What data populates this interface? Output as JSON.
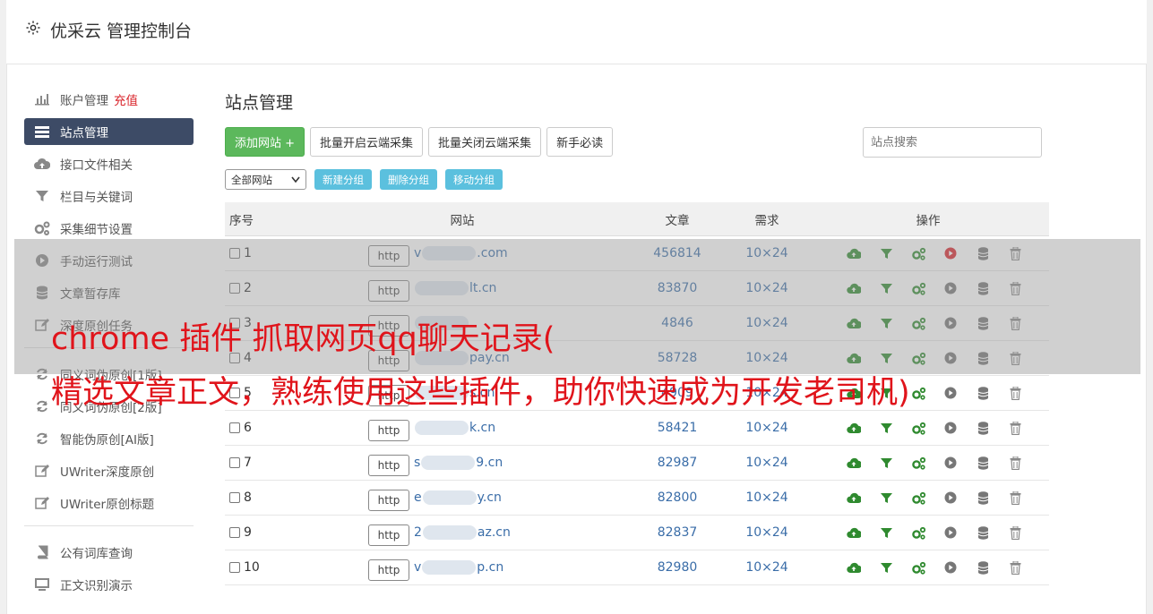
{
  "header": {
    "title": "优采云 管理控制台"
  },
  "sidebar": {
    "items": [
      {
        "label": "账户管理",
        "badge": "充值",
        "icon": "bar-chart-icon"
      },
      {
        "label": "站点管理",
        "icon": "server-icon",
        "active": true
      },
      {
        "label": "接口文件相关",
        "icon": "cloud-upload-icon"
      },
      {
        "label": "栏目与关键词",
        "icon": "filter-icon"
      },
      {
        "label": "采集细节设置",
        "icon": "cogs-icon"
      },
      {
        "label": "手动运行测试",
        "icon": "play-circle-icon"
      },
      {
        "label": "文章暂存库",
        "icon": "database-icon"
      },
      {
        "label": "深度原创任务",
        "icon": "edit-icon"
      },
      {
        "label": "同义词伪原创[1版]",
        "icon": "refresh-icon"
      },
      {
        "label": "同义词伪原创[2版]",
        "icon": "refresh-icon"
      },
      {
        "label": "智能伪原创[AI版]",
        "icon": "refresh-icon"
      },
      {
        "label": "UWriter深度原创",
        "icon": "edit-icon"
      },
      {
        "label": "UWriter原创标题",
        "icon": "edit-icon"
      },
      {
        "label": "公有词库查询",
        "icon": "book-icon"
      },
      {
        "label": "正文识别演示",
        "icon": "monitor-icon"
      }
    ]
  },
  "main": {
    "title": "站点管理",
    "buttons": {
      "add": "添加网站 +",
      "batch_on": "批量开启云端采集",
      "batch_off": "批量关闭云端采集",
      "guide": "新手必读"
    },
    "search_placeholder": "站点搜索",
    "filter": {
      "select_value": "全部网站",
      "new_group": "新建分组",
      "del_group": "删除分组",
      "move_group": "移动分组"
    },
    "table": {
      "headers": {
        "no": "序号",
        "site": "网站",
        "articles": "文章",
        "demand": "需求",
        "ops": "操作"
      },
      "rows": [
        {
          "no": "1",
          "proto": "http",
          "pre": "v",
          "suf": ".com",
          "articles": "456814",
          "demand": "10×24"
        },
        {
          "no": "2",
          "proto": "http",
          "pre": "",
          "suf": "lt.cn",
          "articles": "83870",
          "demand": "10×24"
        },
        {
          "no": "3",
          "proto": "http",
          "pre": "",
          "suf": "",
          "articles": "4846",
          "demand": "10×24"
        },
        {
          "no": "4",
          "proto": "http",
          "pre": "",
          "suf": "pay.cn",
          "articles": "58728",
          "demand": "10×24"
        },
        {
          "no": "5",
          "proto": "http",
          "pre": "",
          "suf": "s.cn",
          "articles": "4909",
          "demand": "10×24"
        },
        {
          "no": "6",
          "proto": "http",
          "pre": "",
          "suf": "k.cn",
          "articles": "58421",
          "demand": "10×24"
        },
        {
          "no": "7",
          "proto": "http",
          "pre": "s",
          "suf": "9.cn",
          "articles": "82987",
          "demand": "10×24"
        },
        {
          "no": "8",
          "proto": "http",
          "pre": "e",
          "suf": "y.cn",
          "articles": "82800",
          "demand": "10×24"
        },
        {
          "no": "9",
          "proto": "http",
          "pre": "2",
          "suf": "az.cn",
          "articles": "82837",
          "demand": "10×24"
        },
        {
          "no": "10",
          "proto": "http",
          "pre": "v",
          "suf": "p.cn",
          "articles": "82980",
          "demand": "10×24"
        }
      ]
    }
  },
  "overlay": {
    "line1": "chrome 插件 抓取网页qq聊天记录(",
    "line2": "精选文章正文，熟练使用这些插件，助你快速成为开发老司机)"
  },
  "colors": {
    "accent_green": "#5cb85c",
    "info_blue": "#5bc0de",
    "active_nav": "#3d4b66",
    "overlay_text": "#e0141b"
  }
}
